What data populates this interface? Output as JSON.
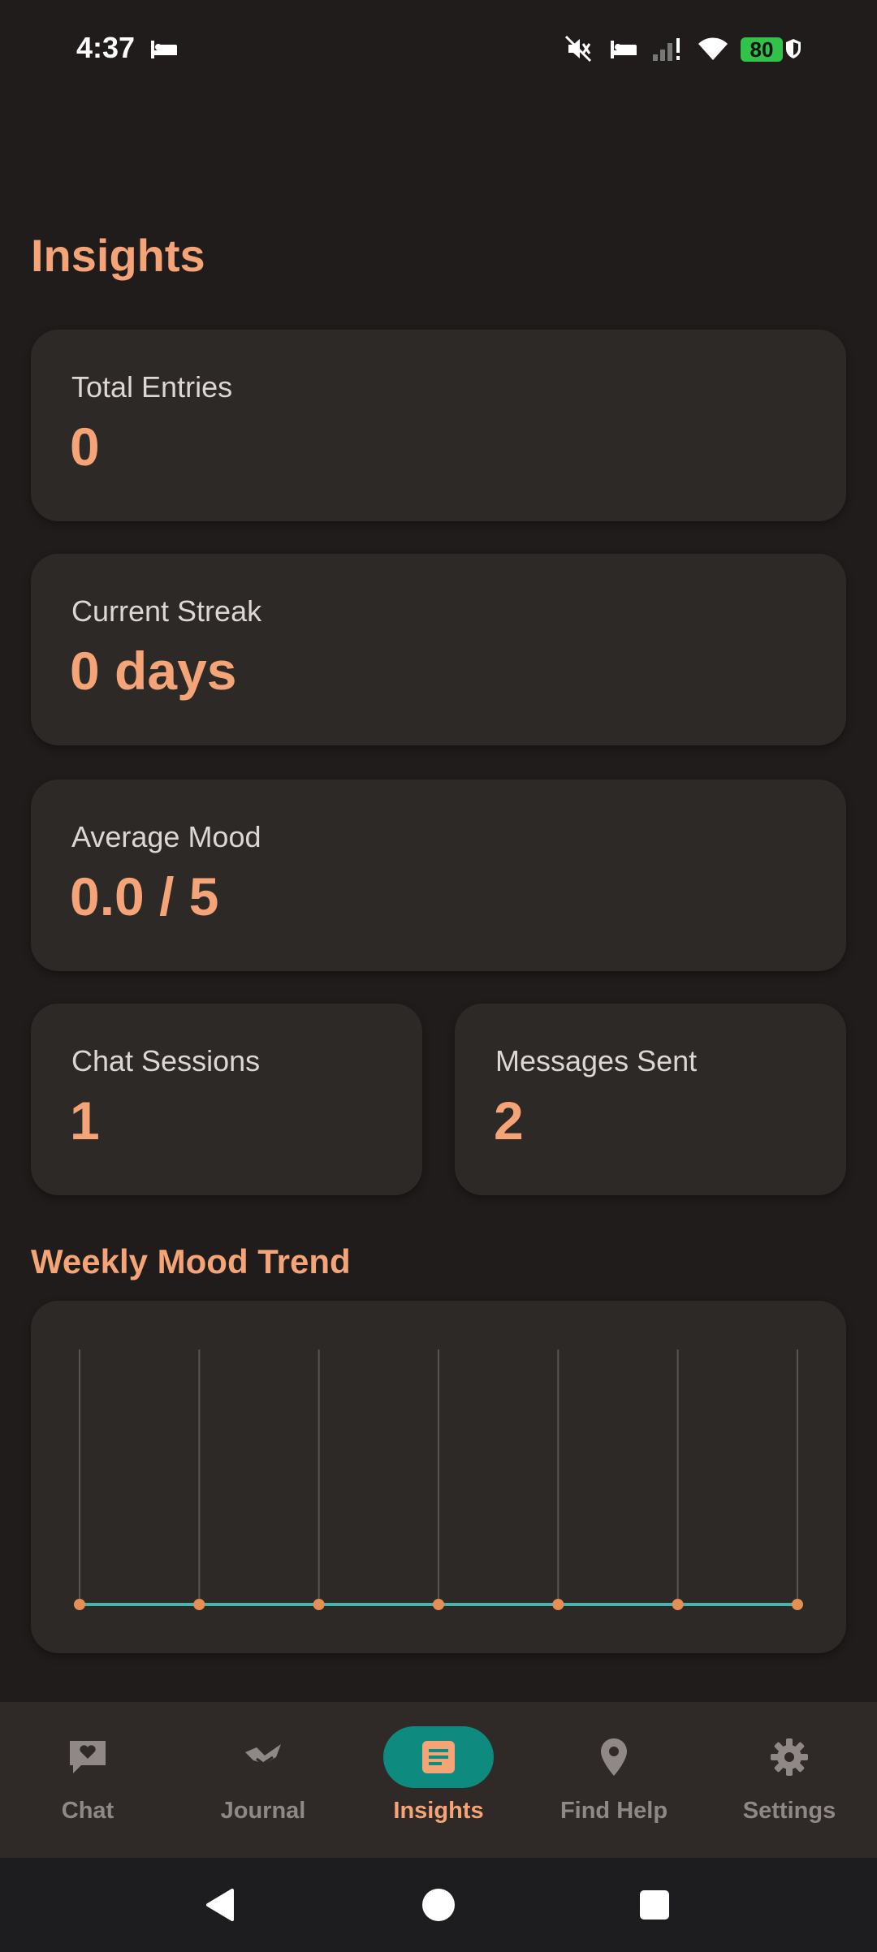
{
  "status_bar": {
    "time": "4:37",
    "battery": "80",
    "icons": [
      "sleep-icon",
      "mute-icon",
      "sleep-icon",
      "signal-icon",
      "wifi-icon",
      "battery-icon",
      "shield-icon"
    ]
  },
  "page": {
    "title": "Insights"
  },
  "stats": {
    "total_entries": {
      "label": "Total Entries",
      "value": "0"
    },
    "current_streak": {
      "label": "Current Streak",
      "value": "0 days"
    },
    "average_mood": {
      "label": "Average Mood",
      "value": "0.0 / 5"
    },
    "chat_sessions": {
      "label": "Chat Sessions",
      "value": "1"
    },
    "messages_sent": {
      "label": "Messages Sent",
      "value": "2"
    }
  },
  "weekly_chart": {
    "title": "Weekly Mood Trend"
  },
  "chart_data": {
    "type": "line",
    "title": "Weekly Mood Trend",
    "x": [
      1,
      2,
      3,
      4,
      5,
      6,
      7
    ],
    "series": [
      {
        "values": [
          0,
          0,
          0,
          0,
          0,
          0,
          0
        ]
      }
    ],
    "grid": "vertical",
    "line_color": "#4bb3aa",
    "point_color": "#e58f54"
  },
  "bottom_nav": {
    "items": [
      {
        "label": "Chat",
        "icon": "chat-heart-icon",
        "active": false
      },
      {
        "label": "Journal",
        "icon": "journal-icon",
        "active": false
      },
      {
        "label": "Insights",
        "icon": "insights-icon",
        "active": true
      },
      {
        "label": "Find Help",
        "icon": "location-icon",
        "active": false
      },
      {
        "label": "Settings",
        "icon": "settings-icon",
        "active": false
      }
    ]
  },
  "colors": {
    "accent": "#f4a476",
    "active_pill": "#0e8a7e",
    "card": "#2d2927",
    "background": "#201c1b"
  }
}
